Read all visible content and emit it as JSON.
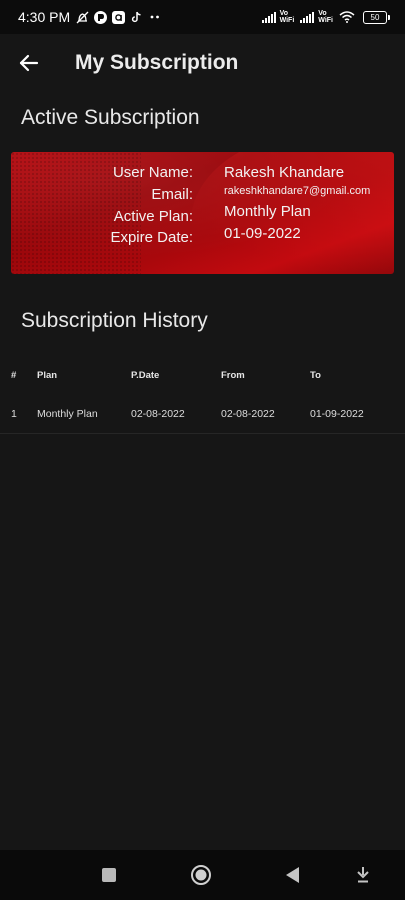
{
  "status_bar": {
    "time": "4:30 PM",
    "left_icons": [
      "muted-notification-icon",
      "app-notification-icon",
      "a-app-icon",
      "tiktok-icon",
      "more-notifications-icon"
    ],
    "vowifi_line1": "Vo",
    "vowifi_line2": "WiFi",
    "battery_level": "50"
  },
  "header": {
    "back_icon": "arrow-left-icon",
    "title": "My Subscription"
  },
  "active_section": {
    "title": "Active Subscription",
    "labels": {
      "user_name": "User Name:",
      "email": "Email:",
      "active_plan": "Active Plan:",
      "expire_date": "Expire Date:"
    },
    "values": {
      "user_name": "Rakesh Khandare",
      "email": "rakeshkhandare7@gmail.com",
      "active_plan": "Monthly Plan",
      "expire_date": "01-09-2022"
    },
    "card_color": "#a8080c"
  },
  "history_section": {
    "title": "Subscription History",
    "columns": [
      "#",
      "Plan",
      "P.Date",
      "From",
      "To"
    ],
    "rows": [
      [
        "1",
        "Monthly Plan",
        "02-08-2022",
        "02-08-2022",
        "01-09-2022"
      ]
    ]
  },
  "nav_bar": {
    "icons": [
      "recents-square-icon",
      "home-circle-icon",
      "back-triangle-icon",
      "keyboard-hide-icon"
    ]
  },
  "colors": {
    "background": "#161616",
    "accent_red": "#b40b10"
  }
}
